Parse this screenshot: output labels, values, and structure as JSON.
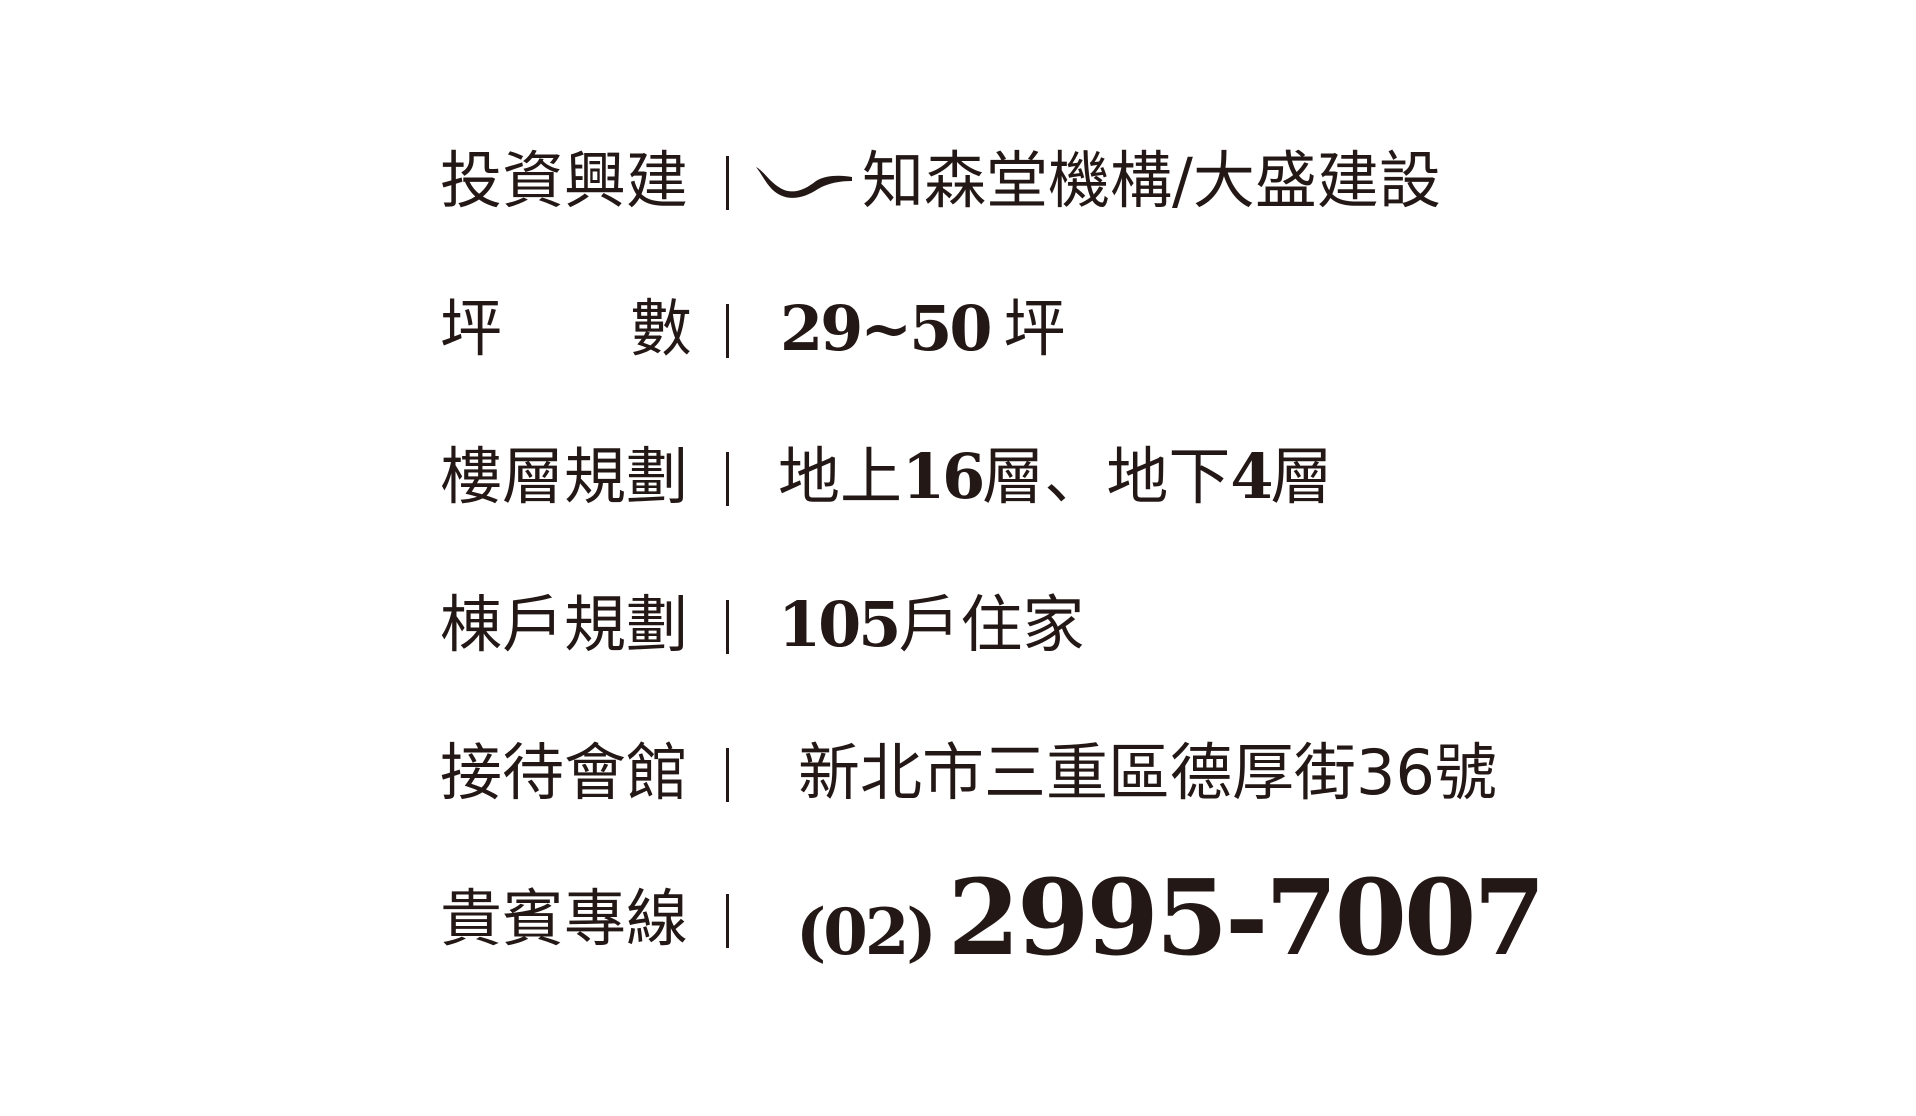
{
  "rows": {
    "developer": {
      "label": "投資興建",
      "logo_icon": "bird-wing-icon",
      "value": "知森堂機構/大盛建設"
    },
    "size": {
      "label_first": "坪",
      "label_second": "數",
      "range": "29~50",
      "unit": "坪"
    },
    "floors": {
      "label": "樓層規劃",
      "above_prefix": "地上",
      "above_count": "16",
      "above_suffix": "層、",
      "below_prefix": "地下",
      "below_count": "4",
      "below_suffix": "層"
    },
    "units": {
      "label": "棟戶規劃",
      "count": "105",
      "suffix": "戶住家"
    },
    "reception": {
      "label": "接待會館",
      "address": "新北市三重區德厚街36號"
    },
    "hotline": {
      "label": "貴賓專線",
      "area_code": "(02)",
      "number": "2995-7007"
    }
  },
  "colors": {
    "text": "#231815",
    "background": "#ffffff"
  }
}
